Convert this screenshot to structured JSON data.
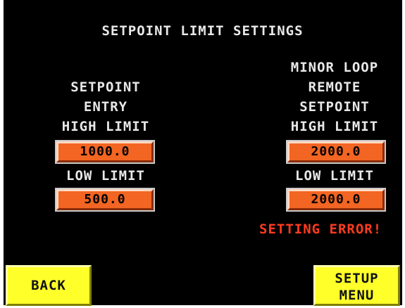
{
  "screen": {
    "title": "SETPOINT LIMIT SETTINGS"
  },
  "left_group": {
    "label_lines": [
      "SETPOINT",
      "ENTRY",
      "HIGH LIMIT"
    ],
    "high_value": "1000.0",
    "low_label": "LOW LIMIT",
    "low_value": "500.0"
  },
  "right_group": {
    "label_lines": [
      "MINOR LOOP",
      "REMOTE",
      "SETPOINT",
      "HIGH LIMIT"
    ],
    "high_value": "2000.0",
    "low_label": "LOW LIMIT",
    "low_value": "2000.0"
  },
  "status": {
    "error_text": "SETTING ERROR!"
  },
  "buttons": {
    "back_label": "BACK",
    "setup_line1": "SETUP",
    "setup_line2": "MENU"
  },
  "colors": {
    "background": "#000000",
    "value_box": "#f26522",
    "button": "#ffff2a",
    "error": "#ff3b1f",
    "text": "#e8e8e8"
  }
}
